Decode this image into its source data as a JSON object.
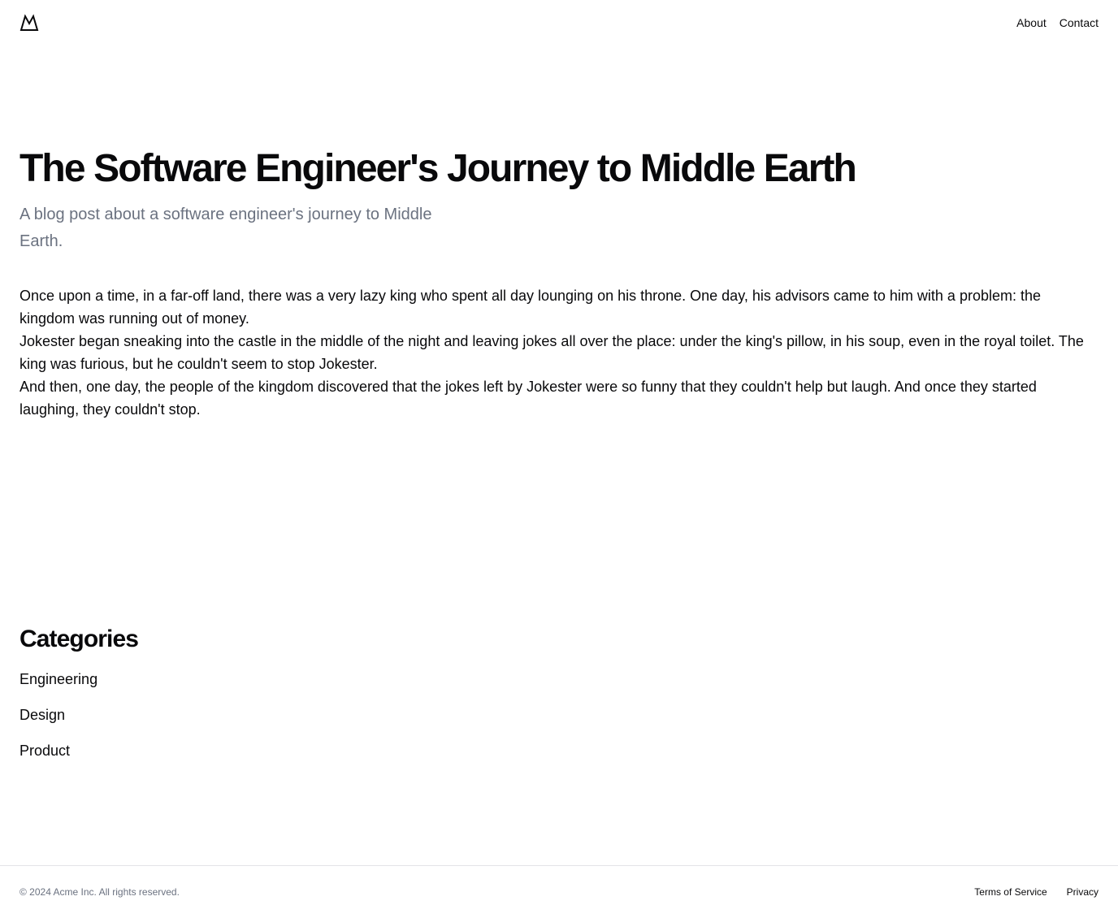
{
  "header": {
    "logo_icon": "mountain-icon",
    "nav": [
      {
        "label": "About"
      },
      {
        "label": "Contact"
      }
    ]
  },
  "post": {
    "title": "The Software Engineer's Journey to Middle Earth",
    "subtitle": "A blog post about a software engineer's journey to Middle Earth.",
    "paragraphs": [
      "Once upon a time, in a far-off land, there was a very lazy king who spent all day lounging on his throne. One day, his advisors came to him with a problem: the kingdom was running out of money.",
      "Jokester began sneaking into the castle in the middle of the night and leaving jokes all over the place: under the king's pillow, in his soup, even in the royal toilet. The king was furious, but he couldn't seem to stop Jokester.",
      "And then, one day, the people of the kingdom discovered that the jokes left by Jokester were so funny that they couldn't help but laugh. And once they started laughing, they couldn't stop."
    ]
  },
  "categories": {
    "heading": "Categories",
    "items": [
      {
        "label": "Engineering"
      },
      {
        "label": "Design"
      },
      {
        "label": "Product"
      }
    ]
  },
  "footer": {
    "copyright": "© 2024 Acme Inc. All rights reserved.",
    "links": [
      {
        "label": "Terms of Service"
      },
      {
        "label": "Privacy"
      }
    ]
  },
  "colors": {
    "text": "#09090b",
    "muted": "#6b7280",
    "border": "#e4e4e7",
    "background": "#ffffff"
  }
}
